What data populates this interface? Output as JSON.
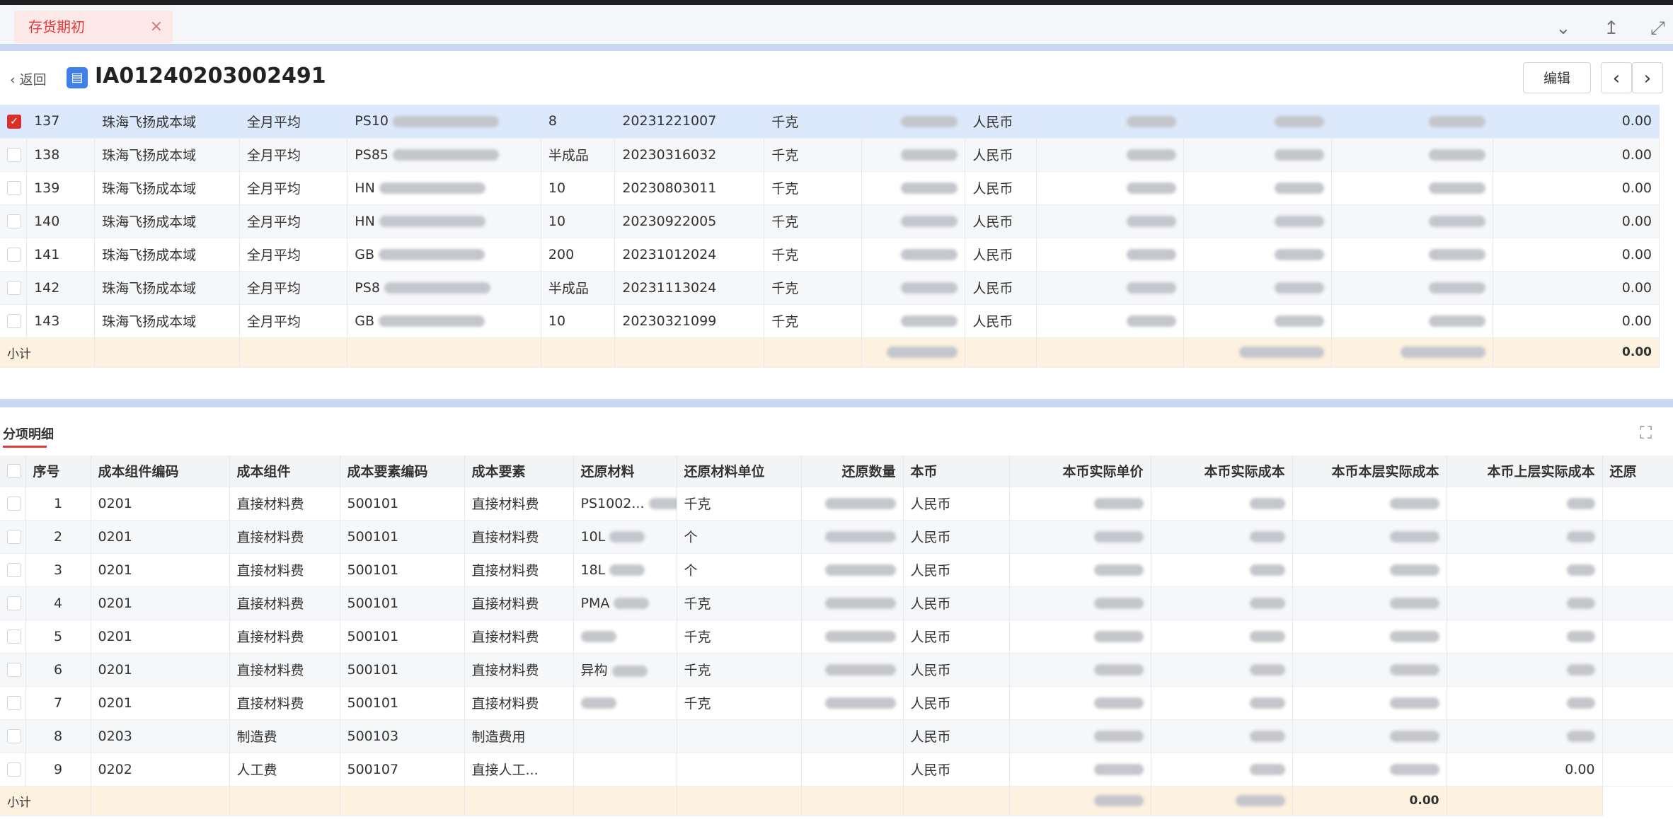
{
  "tab": {
    "label": "存货期初",
    "close": "×"
  },
  "header": {
    "back": "返回",
    "doc_id": "IA01240203002491",
    "edit": "编辑",
    "prev": "‹",
    "next": "›"
  },
  "upper": {
    "rows": [
      {
        "no": "137",
        "org": "珠海飞扬成本域",
        "method": "全月平均",
        "code": "PS10",
        "spec": "8",
        "batch": "20231221007",
        "unit": "千克",
        "currency": "人民币",
        "last": "0.00",
        "selected": true
      },
      {
        "no": "138",
        "org": "珠海飞扬成本域",
        "method": "全月平均",
        "code": "PS85",
        "spec": "半成品",
        "batch": "20230316032",
        "unit": "千克",
        "currency": "人民币",
        "last": "0.00",
        "selected": false
      },
      {
        "no": "139",
        "org": "珠海飞扬成本域",
        "method": "全月平均",
        "code": "HN",
        "spec": "10",
        "batch": "20230803011",
        "unit": "千克",
        "currency": "人民币",
        "last": "0.00",
        "selected": false
      },
      {
        "no": "140",
        "org": "珠海飞扬成本域",
        "method": "全月平均",
        "code": "HN",
        "spec": "10",
        "batch": "20230922005",
        "unit": "千克",
        "currency": "人民币",
        "last": "0.00",
        "selected": false
      },
      {
        "no": "141",
        "org": "珠海飞扬成本域",
        "method": "全月平均",
        "code": "GB",
        "spec": "200",
        "batch": "20231012024",
        "unit": "千克",
        "currency": "人民币",
        "last": "0.00",
        "selected": false
      },
      {
        "no": "142",
        "org": "珠海飞扬成本域",
        "method": "全月平均",
        "code": "PS8",
        "spec": "半成品",
        "batch": "20231113024",
        "unit": "千克",
        "currency": "人民币",
        "last": "0.00",
        "selected": false
      },
      {
        "no": "143",
        "org": "珠海飞扬成本域",
        "method": "全月平均",
        "code": "GB",
        "spec": "10",
        "batch": "20230321099",
        "unit": "千克",
        "currency": "人民币",
        "last": "0.00",
        "selected": false
      }
    ],
    "subtotal_label": "小计",
    "subtotal_last": "0.00"
  },
  "section": {
    "title": "分项明细"
  },
  "lower": {
    "headers": [
      "序号",
      "成本组件编码",
      "成本组件",
      "成本要素编码",
      "成本要素",
      "还原材料",
      "还原材料单位",
      "还原数量",
      "本币",
      "本币实际单价",
      "本币实际成本",
      "本币本层实际成本",
      "本币上层实际成本",
      "还原"
    ],
    "rows": [
      {
        "no": "1",
        "comp_code": "0201",
        "comp": "直接材料费",
        "elem_code": "500101",
        "elem": "直接材料费",
        "mat": "PS1002...",
        "unit": "千克",
        "currency": "人民币",
        "upper": ""
      },
      {
        "no": "2",
        "comp_code": "0201",
        "comp": "直接材料费",
        "elem_code": "500101",
        "elem": "直接材料费",
        "mat": "10L",
        "unit": "个",
        "currency": "人民币",
        "upper": ""
      },
      {
        "no": "3",
        "comp_code": "0201",
        "comp": "直接材料费",
        "elem_code": "500101",
        "elem": "直接材料费",
        "mat": "18L",
        "unit": "个",
        "currency": "人民币",
        "upper": ""
      },
      {
        "no": "4",
        "comp_code": "0201",
        "comp": "直接材料费",
        "elem_code": "500101",
        "elem": "直接材料费",
        "mat": "PMA",
        "unit": "千克",
        "currency": "人民币",
        "upper": ""
      },
      {
        "no": "5",
        "comp_code": "0201",
        "comp": "直接材料费",
        "elem_code": "500101",
        "elem": "直接材料费",
        "mat": "",
        "unit": "千克",
        "currency": "人民币",
        "upper": ""
      },
      {
        "no": "6",
        "comp_code": "0201",
        "comp": "直接材料费",
        "elem_code": "500101",
        "elem": "直接材料费",
        "mat": "异构",
        "unit": "千克",
        "currency": "人民币",
        "upper": ""
      },
      {
        "no": "7",
        "comp_code": "0201",
        "comp": "直接材料费",
        "elem_code": "500101",
        "elem": "直接材料费",
        "mat": "",
        "unit": "千克",
        "currency": "人民币",
        "upper": ""
      },
      {
        "no": "8",
        "comp_code": "0203",
        "comp": "制造费",
        "elem_code": "500103",
        "elem": "制造费用",
        "mat": "",
        "unit": "",
        "currency": "人民币",
        "upper": ""
      },
      {
        "no": "9",
        "comp_code": "0202",
        "comp": "人工费",
        "elem_code": "500107",
        "elem": "直接人工...",
        "mat": "",
        "unit": "",
        "currency": "人民币",
        "upper": "0.00"
      }
    ],
    "subtotal_label": "小计",
    "subtotal_upper": "0.00"
  }
}
